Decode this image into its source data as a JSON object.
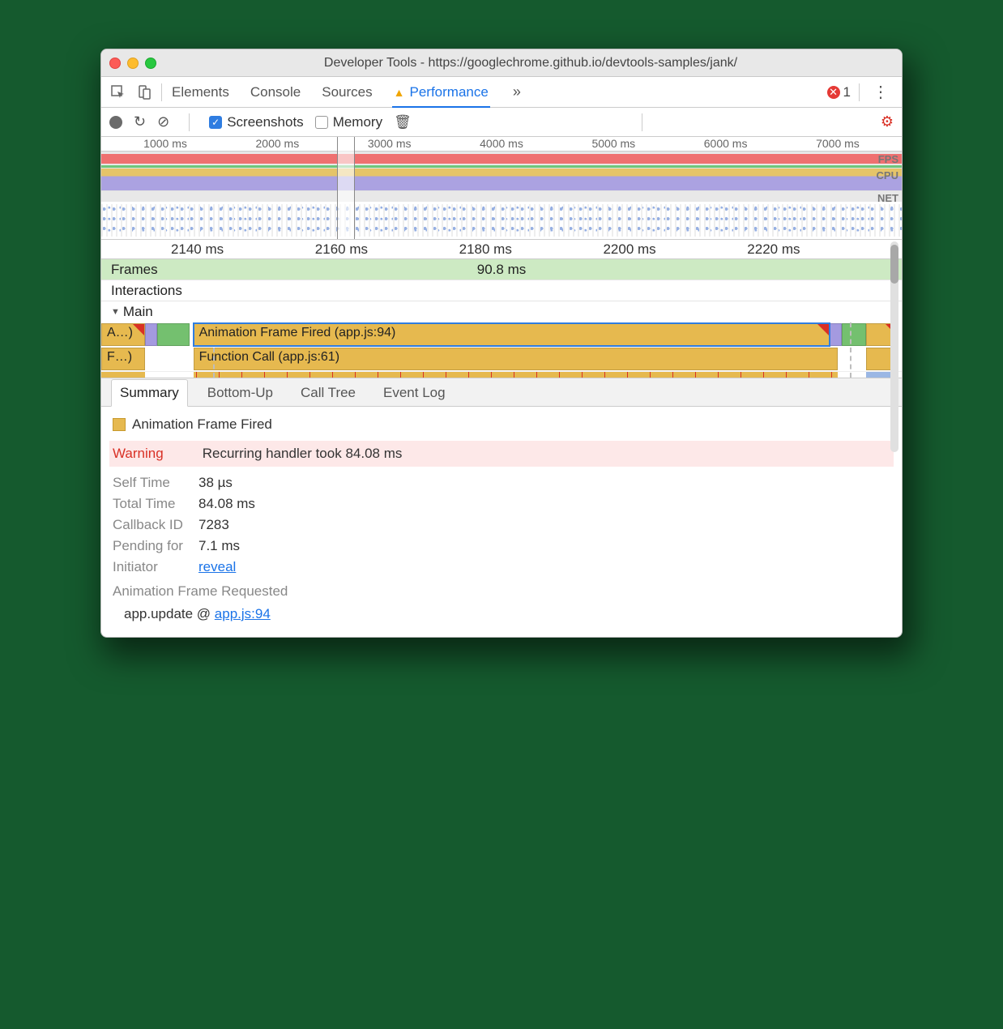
{
  "window": {
    "title": "Developer Tools - https://googlechrome.github.io/devtools-samples/jank/"
  },
  "toolbar1": {
    "tabs": {
      "elements": "Elements",
      "console": "Console",
      "sources": "Sources",
      "performance": "Performance"
    },
    "overflow": "»",
    "errorCount": "1"
  },
  "toolbar2": {
    "screenshots": "Screenshots",
    "memory": "Memory"
  },
  "overview": {
    "ticks": [
      "1000 ms",
      "2000 ms",
      "3000 ms",
      "4000 ms",
      "5000 ms",
      "6000 ms",
      "7000 ms"
    ],
    "lanes": {
      "fps": "FPS",
      "cpu": "CPU",
      "net": "NET"
    }
  },
  "detailRuler": [
    "2140 ms",
    "2160 ms",
    "2180 ms",
    "2200 ms",
    "2220 ms"
  ],
  "tracks": {
    "frames": "Frames",
    "framesValue": "90.8 ms",
    "interactions": "Interactions",
    "main": "Main"
  },
  "flames": {
    "trunc1": "A…)",
    "bar1": "Animation Frame Fired (app.js:94)",
    "trunc2": "F…)",
    "bar2": "Function Call (app.js:61)"
  },
  "bottomTabs": {
    "summary": "Summary",
    "bottomUp": "Bottom-Up",
    "callTree": "Call Tree",
    "eventLog": "Event Log"
  },
  "summary": {
    "title": "Animation Frame Fired",
    "warningLabel": "Warning",
    "warningText": "Recurring handler took 84.08 ms",
    "selfTimeLabel": "Self Time",
    "selfTime": "38 µs",
    "totalTimeLabel": "Total Time",
    "totalTime": "84.08 ms",
    "callbackIdLabel": "Callback ID",
    "callbackId": "7283",
    "pendingLabel": "Pending for",
    "pending": "7.1 ms",
    "initiatorLabel": "Initiator",
    "initiatorLink": "reveal",
    "requested": "Animation Frame Requested",
    "stackFn": "app.update @ ",
    "stackLink": "app.js:94"
  }
}
